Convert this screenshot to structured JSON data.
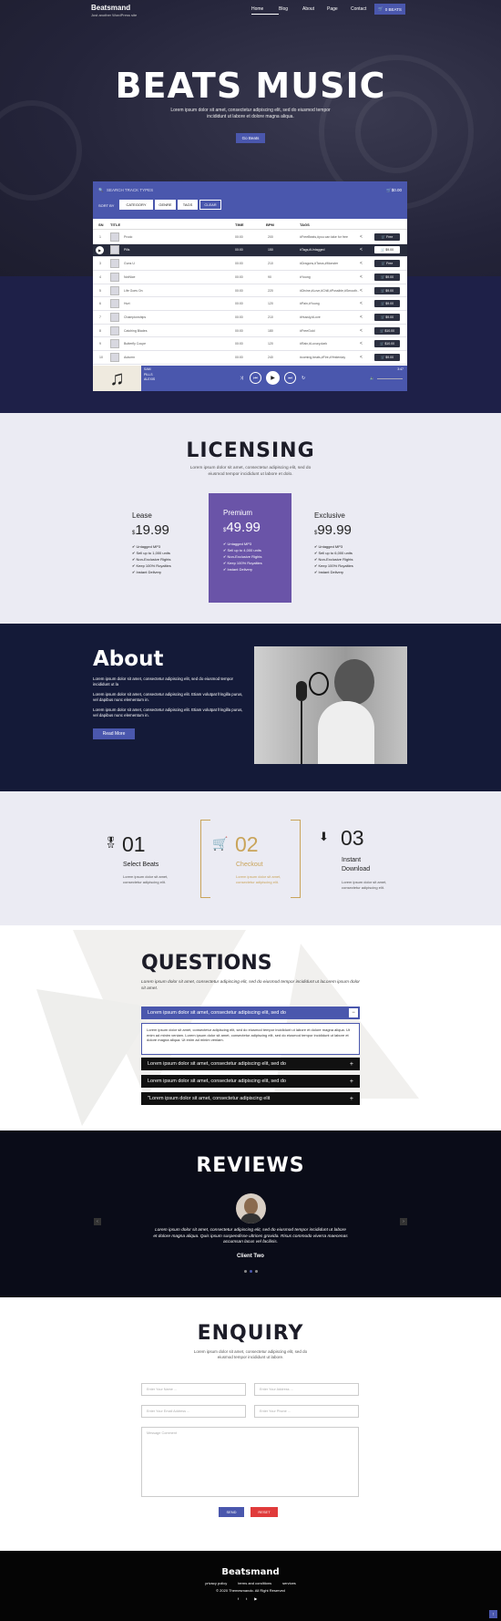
{
  "header": {
    "brand": "Beatsmand",
    "tagline": "Just another WordPress site",
    "nav": [
      "Home",
      "Blog",
      "About",
      "Page",
      "Contact"
    ],
    "cart_label": "0 BEATS",
    "cart_icon": "cart-icon"
  },
  "hero": {
    "title": "BEATS MUSIC",
    "text": "Lorem ipsum dolor sit amet, consectetur adipiscing elit, sed do eiusmod tempor incididunt ut labore et dolore magna aliqua.",
    "button": "Go Beats"
  },
  "player": {
    "search_placeholder": "SEARCH TRACK TYPES",
    "cart_total": "$0.00",
    "sort_label": "SORT BY",
    "filters": [
      "CATEGORY",
      "GENRE",
      "TAGS",
      "CLEAR"
    ],
    "columns": [
      "SN",
      "TITLE",
      "TIME",
      "BPM",
      "TAGS"
    ],
    "tracks": [
      {
        "sn": "1",
        "title": "Prodo",
        "time": "00:00",
        "bpm": "200",
        "tags": "#FreeBeats,#you can take for free",
        "price": "Free"
      },
      {
        "sn": "",
        "title": "Pills",
        "time": "00:00",
        "bpm": "150",
        "tags": "#Tags,#Untagged",
        "price": "$9.00"
      },
      {
        "sn": "3",
        "title": "Guns U",
        "time": "00:00",
        "bpm": "210",
        "tags": "#Dragons,#Tarus,#Monster",
        "price": "Free"
      },
      {
        "sn": "4",
        "title": "NotNice",
        "time": "00:00",
        "bpm": "90",
        "tags": "#Young",
        "price": "$9.00"
      },
      {
        "sn": "5",
        "title": "Life Goes On",
        "time": "00:00",
        "bpm": "220",
        "tags": "#Divine,#Love,#Chill,#Possible,#Smooth...",
        "price": "$9.00"
      },
      {
        "sn": "6",
        "title": "Hurt",
        "time": "00:00",
        "bpm": "120",
        "tags": "#Pain,#Young",
        "price": "$9.00"
      },
      {
        "sn": "7",
        "title": "Championships",
        "time": "00:00",
        "bpm": "210",
        "tags": "#Hussly,#Love",
        "price": "$9.00"
      },
      {
        "sn": "8",
        "title": "Catching Blades",
        "time": "00:00",
        "bpm": "180",
        "tags": "#FreeGold",
        "price": "$10.00"
      },
      {
        "sn": "9",
        "title": "Butterfly Coupe",
        "time": "00:00",
        "bpm": "120",
        "tags": "#Rain,#Luxury,dark",
        "price": "$10.00"
      },
      {
        "sn": "10",
        "title": "Autumn",
        "time": "00:00",
        "bpm": "240",
        "tags": "#coming,beats,#Fire,#Yesterday",
        "price": "$9.00"
      }
    ],
    "now_playing": {
      "artist": "SAM",
      "track": "PILLS",
      "label": "ALEXIS",
      "time": "3:47"
    }
  },
  "licensing": {
    "title": "LICENSING",
    "text": "Lorem ipsum dolor sit amet, consectetur adipiscing elit, sed do eiusmod tempor incididunt ut labore et dolo.",
    "plans": [
      {
        "name": "Lease",
        "price": "19.99",
        "features": [
          "Untagged MP3",
          "Sell up to 1,000 units",
          "Non-Exclusive Rights",
          "Keep 100% Royalties",
          "Instant Delivery"
        ]
      },
      {
        "name": "Premium",
        "price": "49.99",
        "features": [
          "Untagged MP3",
          "Sell up to 4,000 units",
          "Non-Exclusive Rights",
          "Keep 100% Royalties",
          "Instant Delivery"
        ]
      },
      {
        "name": "Exclusive",
        "price": "99.99",
        "features": [
          "Untagged MP3",
          "Sell up to 6,000 units",
          "Non-Exclusive Rights",
          "Keep 100% Royalties",
          "Instant Delivery"
        ]
      }
    ]
  },
  "about": {
    "title": "About",
    "p1": "Lorem ipsum dolor sit amet, consectetur adipiscing elit, sed do eiusmod tempor incididunt ut la",
    "p2": "Lorem ipsum dolor sit amet, consectetur adipiscing elit. Etiam volutpat fringilla purus, vel dapibus nunc elementum in.",
    "p3": "Lorem ipsum dolor sit amet, consectetur adipiscing elit. Etiam volutpat fringilla purus, vel dapibus nunc elementum in.",
    "button": "Read More"
  },
  "steps": [
    {
      "num": "01",
      "title": "Select Beats",
      "text": "Lorem ipsum dolor sit amet, consectetur adipiscing elit."
    },
    {
      "num": "02",
      "title": "Checkout",
      "text": "Lorem ipsum dolor sit amet, consectetur adipiscing elit."
    },
    {
      "num": "03",
      "title": "Instant Download",
      "text": "Lorem ipsum dolor sit amet, consectetur adipiscing elit."
    }
  ],
  "questions": {
    "title": "QUESTIONS",
    "text": "Lorem ipsum dolor sit amet, consectetur adipiscing elit, sed do eiusmod tempor incididunt ut laLorem ipsum dolor sit amet.",
    "items": [
      {
        "q": "Lorem ipsum dolor sit amet, consectetur adipiscing elit, sed do",
        "a": "Lorem ipsum dolor sit amet, consectetur adipiscing elit, sed do eiusmod tempor incididunt ut labore et dolore magna aliqua. Ut enim ad minim veniam. Lorem ipsum dolor sit amet, consectetur adipiscing elit, sed do eiusmod tempor incididunt ut labore et dolore magna aliqua. Ut enim ad minim veniam."
      },
      {
        "q": "Lorem ipsum dolor sit amet, consectetur adipiscing elit, sed do"
      },
      {
        "q": "Lorem ipsum dolor sit amet, consectetur adipiscing elit, sed do"
      },
      {
        "q": "\"Lorem ipsum dolor sit amet, consectetur adipiscing elit"
      }
    ]
  },
  "reviews": {
    "title": "REVIEWS",
    "text": "Lorem ipsum dolor sit amet, consectetur adipiscing elit, sed do eiusmod tempor incididunt ut labore et dolore magna aliqua. Quis ipsum suspendisse ultrices gravida. Risus commodo viverra maecenas accumsan lacus vel facilisis.",
    "client": "Client Two"
  },
  "enquiry": {
    "title": "ENQUIRY",
    "text": "Lorem ipsum dolor sit amet, consectetur adipiscing elit, sed do eiusmod tempor incididunt ut labore.",
    "name_ph": "Enter Your Name ...",
    "address_ph": "Enter Your Address ...",
    "email_ph": "Enter Your Email Address ...",
    "phone_ph": "Enter Your Phone ...",
    "message_ph": "Message Comment",
    "send": "SEND",
    "reset": "RESET"
  },
  "footer": {
    "brand": "Beatsmand",
    "links": [
      "privacy policy",
      "terms and conditions",
      "services"
    ],
    "copy": "© 2020 Themesmando. All Right Reserved"
  },
  "colors": {
    "accent": "#4a57ad",
    "premium": "#6a54a8",
    "gold": "#c9a45a",
    "navy": "#141a38"
  }
}
